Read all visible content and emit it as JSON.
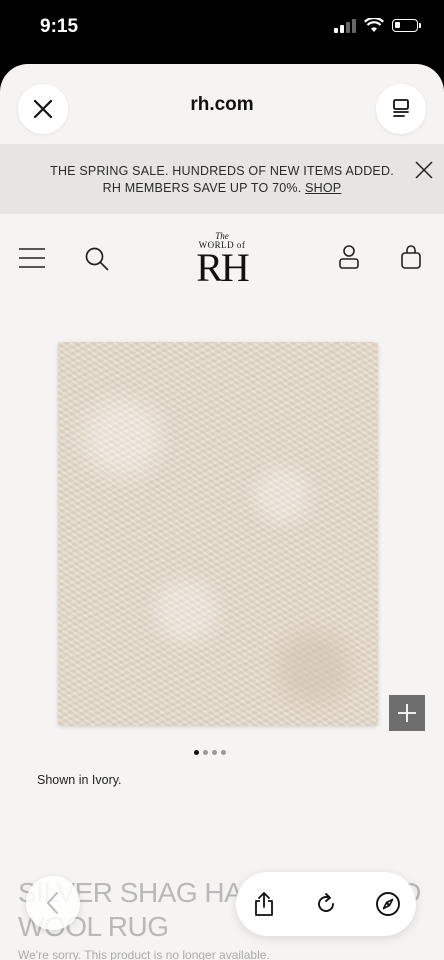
{
  "status_bar": {
    "time": "9:15",
    "battery_level": 0.25
  },
  "browser": {
    "url": "rh.com"
  },
  "promo": {
    "line1": "THE SPRING SALE. HUNDREDS OF NEW ITEMS ADDED.",
    "line2": "RH MEMBERS SAVE UP TO 70%.",
    "link": "SHOP"
  },
  "logo": {
    "top": "The",
    "mid": "WORLD of",
    "main": "RH"
  },
  "gallery": {
    "dots_total": 4,
    "active_dot": 1,
    "caption": "Shown in Ivory."
  },
  "product": {
    "title_line1": "SILVER SHAG HAND-KNOTTED",
    "title_line2": "WOOL RUG",
    "notice": "We're sorry. This product is no longer available."
  },
  "icons": {
    "close": "close-icon",
    "tabs": "tabs-icon",
    "promo_close": "close-icon",
    "menu": "menu-icon",
    "search": "search-icon",
    "account": "user-icon",
    "cart": "shopping-bag-icon",
    "zoom": "plus-icon",
    "back": "chevron-left-icon",
    "share": "share-icon",
    "reload": "reload-icon",
    "compass": "compass-icon"
  },
  "colors": {
    "page_bg": "#f5f4f2",
    "promo_bg": "#e6e5e3",
    "rug": "#e3d8c9",
    "zoom_btn": "#6e6e6e"
  }
}
